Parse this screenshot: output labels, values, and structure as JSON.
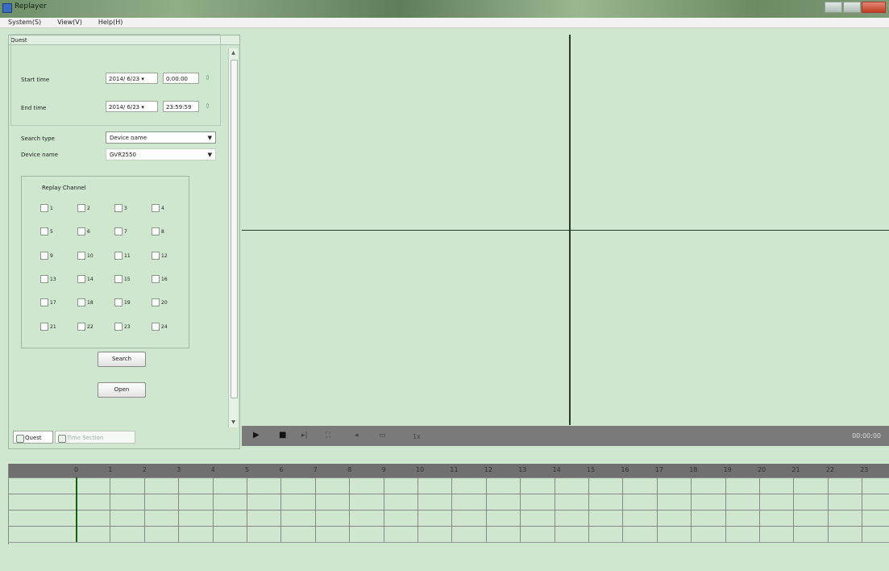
{
  "window": {
    "title": "Replayer"
  },
  "menu": [
    "System(S)",
    "View(V)",
    "Help(H)"
  ],
  "panel": {
    "header": "Quest",
    "start_label": "Start time",
    "start_date": "2014/ 6/23",
    "start_time": "0:00:00",
    "end_label": "End time",
    "end_date": "2014/ 6/23",
    "end_time": "23:59:59",
    "search_type_label": "Search type",
    "search_type_value": "Device name",
    "device_name_label": "Device name",
    "device_name_value": "GVR2550",
    "channel_title": "Replay Channel",
    "channels": [
      "1",
      "2",
      "3",
      "4",
      "5",
      "6",
      "7",
      "8",
      "9",
      "10",
      "11",
      "12",
      "13",
      "14",
      "15",
      "16",
      "17",
      "18",
      "19",
      "20",
      "21",
      "22",
      "23",
      "24"
    ],
    "search_button": "Search",
    "open_button": "Open"
  },
  "tabs": [
    "Quest",
    "Time Section"
  ],
  "player": {
    "time": "00:00:00",
    "speed_label": "1x"
  },
  "timeline": {
    "hours": [
      "0",
      "1",
      "2",
      "3",
      "4",
      "5",
      "6",
      "7",
      "8",
      "9",
      "10",
      "11",
      "12",
      "13",
      "14",
      "15",
      "16",
      "17",
      "18",
      "19",
      "20",
      "21",
      "22",
      "23"
    ]
  }
}
